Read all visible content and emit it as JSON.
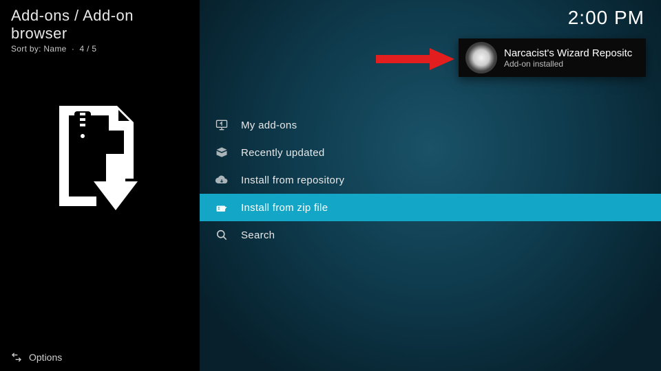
{
  "header": {
    "breadcrumb": "Add-ons / Add-on browser",
    "sort_prefix": "Sort by:",
    "sort_value": "Name",
    "sort_sep": "·",
    "position": "4 / 5"
  },
  "clock": "2:00 PM",
  "menu": {
    "selected_index": 3,
    "items": [
      {
        "icon": "monitor-icon",
        "label": "My add-ons"
      },
      {
        "icon": "box-open-icon",
        "label": "Recently updated"
      },
      {
        "icon": "cloud-down-icon",
        "label": "Install from repository"
      },
      {
        "icon": "zip-file-icon",
        "label": "Install from zip file"
      },
      {
        "icon": "search-icon",
        "label": "Search"
      }
    ]
  },
  "toast": {
    "title": "Narcacist's Wizard Repositc",
    "subtitle": "Add-on installed"
  },
  "footer": {
    "options_label": "Options"
  }
}
